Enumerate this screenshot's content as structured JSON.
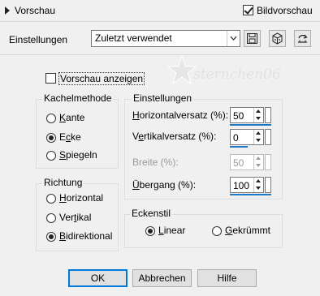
{
  "header": {
    "section_title": "Vorschau",
    "preview_label": "Bildvorschau",
    "preview_checked": true
  },
  "settings_row": {
    "label": "Einstellungen",
    "preset_value": "Zuletzt verwendet"
  },
  "preview": {
    "show_label": "Vorschau anzeigen",
    "checked": false,
    "watermark": "sternchen06"
  },
  "tile_method": {
    "title": "Kachelmethode",
    "options": [
      {
        "label": "Kante",
        "selected": false
      },
      {
        "label": "Ecke",
        "selected": true
      },
      {
        "label": "Spiegeln",
        "selected": false
      }
    ]
  },
  "direction": {
    "title": "Richtung",
    "options": [
      {
        "label": "Horizontal",
        "selected": false
      },
      {
        "label": "Vertikal",
        "selected": false
      },
      {
        "label": "Bidirektional",
        "selected": true
      }
    ]
  },
  "settings_group": {
    "title": "Einstellungen",
    "fields": [
      {
        "label": "Horizontalversatz (%):",
        "value": "50",
        "enabled": true
      },
      {
        "label": "Vertikalversatz (%):",
        "value": "0",
        "enabled": true
      },
      {
        "label": "Breite (%):",
        "value": "50",
        "enabled": false
      },
      {
        "label": "Übergang (%):",
        "value": "100",
        "enabled": true
      }
    ]
  },
  "corner_style": {
    "title": "Eckenstil",
    "options": [
      {
        "label": "Linear",
        "selected": true
      },
      {
        "label": "Gekrümmt",
        "selected": false
      }
    ]
  },
  "buttons": {
    "ok": "OK",
    "cancel": "Abbrechen",
    "help": "Hilfe"
  },
  "icons": [
    "expand-arrow-icon",
    "save-preset-icon",
    "random-dice-icon",
    "reset-icon",
    "star-icon"
  ]
}
